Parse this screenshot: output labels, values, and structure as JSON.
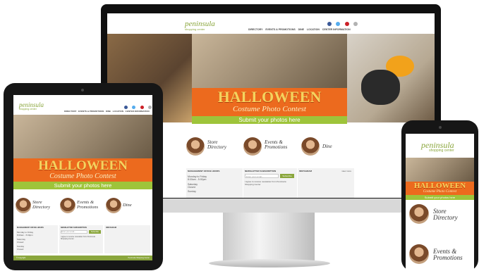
{
  "site": {
    "logo": "peninsula",
    "logo_sub": "shopping center",
    "nav": [
      "DIRECTORY",
      "EVENTS & PROMOTIONS",
      "DINE",
      "LOCATION",
      "CENTER INFORMATION"
    ],
    "social_colors": [
      "#3b5998",
      "#55acee",
      "#cb2027",
      "#b2b2b2"
    ],
    "banner": {
      "title": "HALLOWEEN",
      "subtitle": "Costume Photo Contest",
      "cta": "Submit your photos here"
    },
    "quick_links": [
      {
        "label": "Store Directory"
      },
      {
        "label": "Events & Promotions"
      },
      {
        "label": "Dine"
      }
    ],
    "info": {
      "hours_title": "MANAGEMENT OFFICE HOURS",
      "hours_lines": [
        "Monday to Friday",
        "8:00am - 5:00pm",
        "Saturday",
        "Closed",
        "Sunday",
        "Closed"
      ],
      "newsletter_title": "NEWSLETTER SUBSCRIPTION",
      "newsletter_placeholder": "Enter your email...",
      "subscribe_label": "Subscribe",
      "newsletter_optin": "I agree to receive newsletter from Peninsula Shopping Center",
      "instagram_title": "INSTAGRAM",
      "instagram_link": "view more"
    },
    "footer_left": "© Copyright",
    "footer_right": "Peninsula Shopping Center"
  },
  "colors": {
    "brand_green": "#8aa63c",
    "banner_orange": "#ec6a1e",
    "banner_lime": "#9ec43a",
    "title_yellow": "#f4d35e"
  }
}
